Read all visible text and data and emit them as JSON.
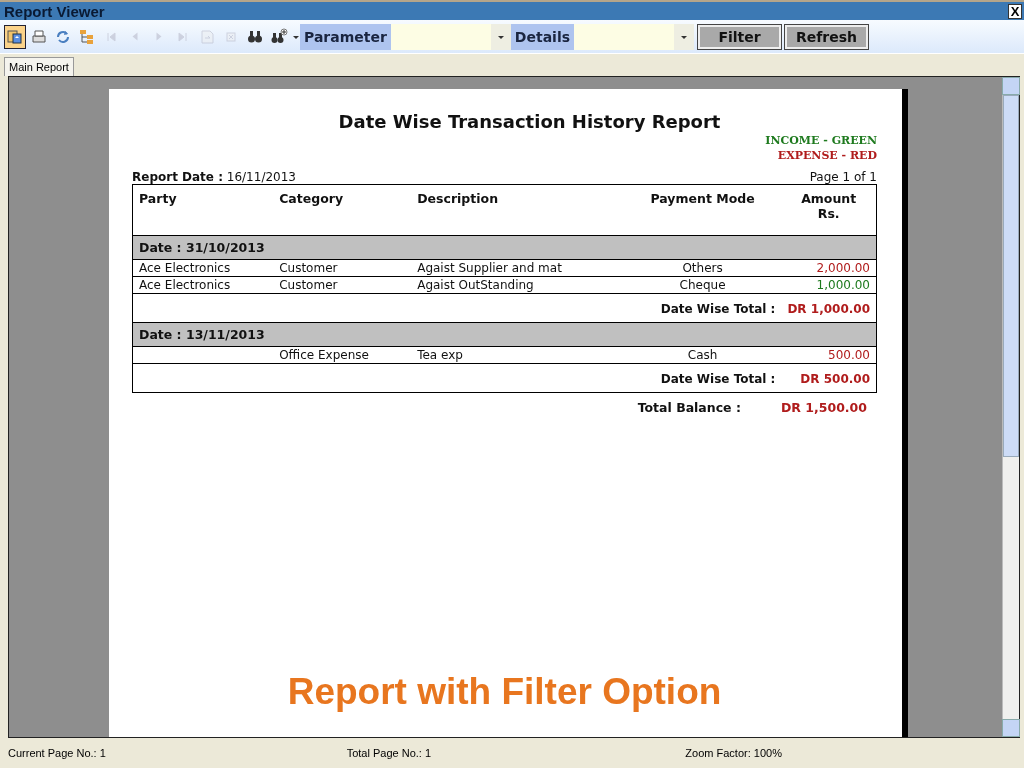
{
  "window": {
    "title": "Report Viewer",
    "close": "X"
  },
  "toolbar": {
    "icons": [
      {
        "kind": "export",
        "disabled": false,
        "selected": true
      },
      {
        "kind": "print",
        "disabled": false,
        "selected": false
      },
      {
        "kind": "refresh",
        "disabled": false,
        "selected": false
      },
      {
        "kind": "tree",
        "disabled": false,
        "selected": false
      },
      {
        "kind": "first",
        "disabled": true,
        "selected": false
      },
      {
        "kind": "prev",
        "disabled": true,
        "selected": false
      },
      {
        "kind": "next",
        "disabled": true,
        "selected": false
      },
      {
        "kind": "last",
        "disabled": true,
        "selected": false
      },
      {
        "kind": "goto",
        "disabled": true,
        "selected": false
      },
      {
        "kind": "stop",
        "disabled": true,
        "selected": false
      },
      {
        "kind": "search",
        "disabled": false,
        "selected": false
      },
      {
        "kind": "zoom",
        "disabled": false,
        "selected": false
      }
    ],
    "filters": [
      {
        "label": "Parameter"
      },
      {
        "label": "Details"
      }
    ],
    "buttons": [
      "Filter",
      "Refresh"
    ]
  },
  "tabs": [
    {
      "label": "Main Report",
      "selected": true
    }
  ],
  "report": {
    "title": "Date Wise Transaction History Report",
    "legend": [
      {
        "text": "INCOME - GREEN",
        "color": "#1e7a1e"
      },
      {
        "text": "EXPENSE - RED",
        "color": "#b01c1c"
      }
    ],
    "report_date_label": "Report Date :",
    "report_date": "16/11/2013",
    "page": "Page 1 of 1",
    "columns": [
      "Party",
      "Category",
      "Description",
      "Payment Mode",
      "Amount\nRs."
    ],
    "rows": [
      {
        "kind": "group",
        "text": "Date : 31/10/2013"
      },
      {
        "kind": "item",
        "cells": [
          "Ace Electronics",
          "Customer",
          "Agaist Supplier and mat",
          "Others",
          "2,000.00"
        ],
        "color": "#b01c1c"
      },
      {
        "kind": "item",
        "cells": [
          "Ace Electronics",
          "Customer",
          "Agaist OutStanding",
          "Cheque",
          "1,000.00"
        ],
        "color": "#1e7a1e"
      },
      {
        "kind": "total",
        "label": "Date Wise Total :",
        "value": "DR 1,000.00"
      },
      {
        "kind": "group",
        "text": "Date : 13/11/2013"
      },
      {
        "kind": "item",
        "cells": [
          "",
          "Office Expense",
          "Tea exp",
          "Cash",
          "500.00"
        ],
        "color": "#b01c1c"
      },
      {
        "kind": "total",
        "label": "Date Wise Total :",
        "value": "DR 500.00"
      }
    ],
    "balance_label": "Total Balance :",
    "balance": "DR 1,500.00"
  },
  "caption": "Report with Filter Option",
  "status_bar": [
    "Current Page No.: 1",
    "Total Page No.: 1",
    "Zoom Factor: 100%"
  ]
}
